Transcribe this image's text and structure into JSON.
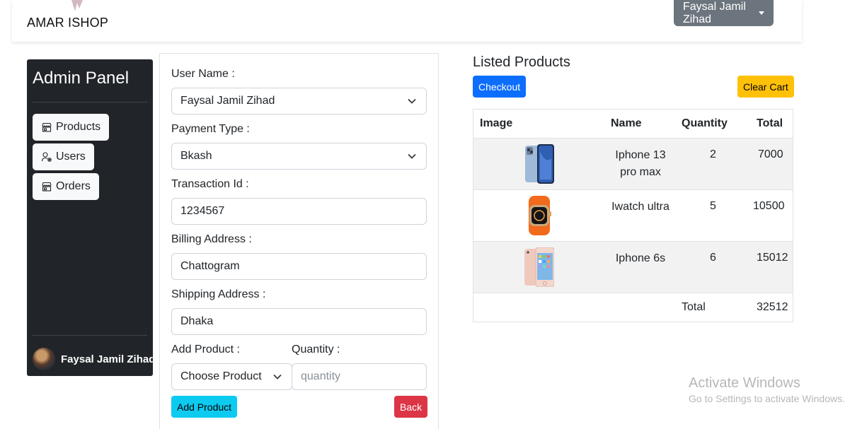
{
  "header": {
    "brand": "AMAR ISHOP",
    "user_menu_label": "Faysal Jamil Zihad"
  },
  "sidebar": {
    "title": "Admin Panel",
    "items": [
      {
        "label": "Products",
        "icon": "shop-icon"
      },
      {
        "label": "Users",
        "icon": "user-gear-icon"
      },
      {
        "label": "Orders",
        "icon": "shop-icon"
      }
    ],
    "user_name": "Faysal Jamil Zihad"
  },
  "form": {
    "user_name_label": "User Name :",
    "user_name_value": "Faysal Jamil Zihad",
    "payment_type_label": "Payment Type :",
    "payment_type_value": "Bkash",
    "transaction_id_label": "Transaction Id :",
    "transaction_id_value": "1234567",
    "billing_address_label": "Billing Address :",
    "billing_address_value": "Chattogram",
    "shipping_address_label": "Shipping Address :",
    "shipping_address_value": "Dhaka",
    "add_product_label": "Add Product :",
    "add_product_value": "Choose Product",
    "quantity_label": "Quantity :",
    "quantity_placeholder": "quantity",
    "add_product_button": "Add Product",
    "back_button": "Back"
  },
  "listed": {
    "title": "Listed Products",
    "checkout_button": "Checkout",
    "clear_cart_button": "Clear Cart",
    "columns": [
      "Image",
      "Name",
      "Quantity",
      "Total"
    ],
    "rows": [
      {
        "name_line1": "Iphone 13",
        "name_line2": "pro max",
        "quantity": "2",
        "total": "7000"
      },
      {
        "name_line1": "Iwatch ultra",
        "name_line2": "",
        "quantity": "5",
        "total": "10500"
      },
      {
        "name_line1": "Iphone 6s",
        "name_line2": "",
        "quantity": "6",
        "total": "15012"
      }
    ],
    "footer_label": "Total",
    "footer_total": "32512"
  },
  "watermark": {
    "line1": "Activate Windows",
    "line2": "Go to Settings to activate Windows."
  },
  "colors": {
    "sidebar_bg": "#212529",
    "primary": "#0d6efd",
    "warning": "#ffc107",
    "info": "#0dcaf0",
    "danger": "#dc3545",
    "secondary": "#6c757d"
  }
}
